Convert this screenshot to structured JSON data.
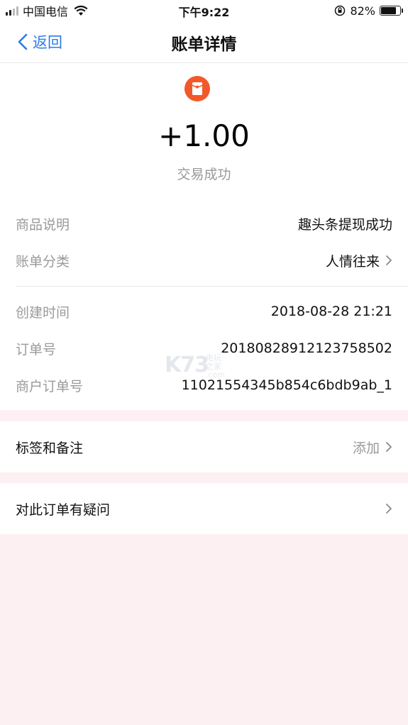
{
  "status_bar": {
    "carrier": "中国电信",
    "time": "下午9:22",
    "battery_percent": "82%",
    "battery_level": 0.82,
    "icons": [
      "signal-icon",
      "wifi-icon",
      "orientation-lock-icon",
      "battery-icon"
    ]
  },
  "nav": {
    "back_label": "返回",
    "title": "账单详情"
  },
  "transaction": {
    "icon": "red-packet-icon",
    "icon_color": "#f2592a",
    "amount": "+1.00",
    "status": "交易成功"
  },
  "details": {
    "product_label": "商品说明",
    "product_value": "趣头条提现成功",
    "category_label": "账单分类",
    "category_value": "人情往来",
    "created_label": "创建时间",
    "created_value": "2018-08-28 21:21",
    "order_label": "订单号",
    "order_value": "2018082891212375850​2",
    "merchant_order_label": "商户订单号",
    "merchant_order_value": "11021554345b854c6bdb9ab_1"
  },
  "watermark": {
    "logo": "K73",
    "text1": "电玩之家",
    "text2": ".com"
  },
  "tags": {
    "label": "标签和备注",
    "action": "添加"
  },
  "question": {
    "label": "对此订单有疑问"
  },
  "colors": {
    "accent": "#2c7be5",
    "background": "#fdf0f3"
  }
}
